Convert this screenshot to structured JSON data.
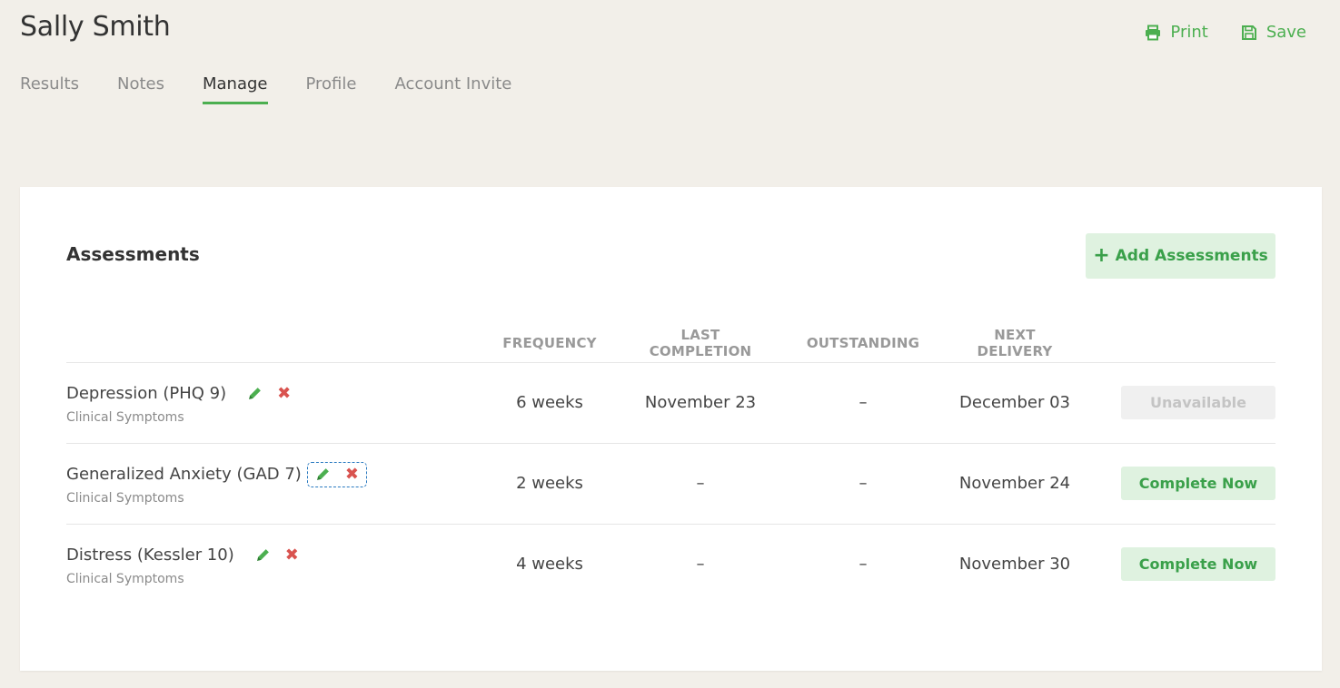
{
  "header": {
    "title": "Sally Smith",
    "print_label": "Print",
    "save_label": "Save"
  },
  "tabs": [
    {
      "label": "Results",
      "active": false
    },
    {
      "label": "Notes",
      "active": false
    },
    {
      "label": "Manage",
      "active": true
    },
    {
      "label": "Profile",
      "active": false
    },
    {
      "label": "Account Invite",
      "active": false
    }
  ],
  "assessments": {
    "title": "Assessments",
    "add_label": "Add Assessments",
    "columns": {
      "frequency": "FREQUENCY",
      "last_completion": "LAST COMPLETION",
      "outstanding": "OUTSTANDING",
      "next_delivery": "NEXT DELIVERY"
    },
    "rows": [
      {
        "name": "Depression (PHQ 9)",
        "category": "Clinical Symptoms",
        "frequency": "6 weeks",
        "last_completion": "November 23",
        "outstanding": "–",
        "next_delivery": "December 03",
        "action": "Unavailable"
      },
      {
        "name": "Generalized Anxiety (GAD 7)",
        "category": "Clinical Symptoms",
        "frequency": "2 weeks",
        "last_completion": "–",
        "outstanding": "–",
        "next_delivery": "November 24",
        "action": "Complete Now"
      },
      {
        "name": "Distress (Kessler 10)",
        "category": "Clinical Symptoms",
        "frequency": "4 weeks",
        "last_completion": "–",
        "outstanding": "–",
        "next_delivery": "November 30",
        "action": "Complete Now"
      }
    ]
  },
  "colors": {
    "accent": "#4caf50",
    "delete": "#d9534f",
    "background": "#f2efe9"
  }
}
